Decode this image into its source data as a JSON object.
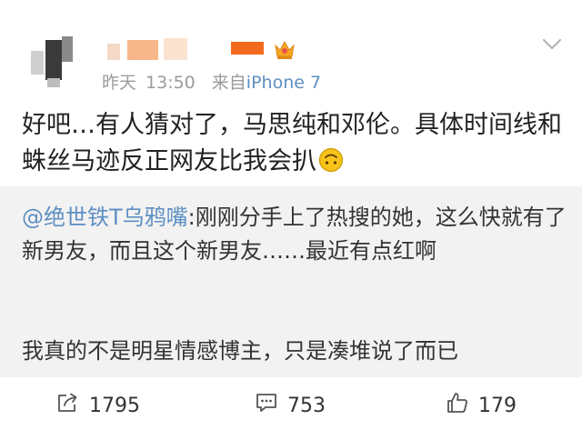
{
  "post": {
    "time_prefix": "昨天",
    "time": "13:50",
    "source_prefix": "来自",
    "source_device": "iPhone 7",
    "text": "好吧…有人猜对了，马思纯和邓伦。具体时间线和蛛丝马迹反正网友比我会扒",
    "emoji_icon": "upside-down-face-icon"
  },
  "repost": {
    "author": "@绝世铁T乌鸦嘴",
    "separator": ":",
    "text": "刚刚分手上了热搜的她，这么快就有了新男友，而且这个新男友……最近有点红啊",
    "extra": "我真的不是明星情感博主，只是凑堆说了而已"
  },
  "actions": {
    "repost_count": "1795",
    "comment_count": "753",
    "like_count": "179"
  },
  "colors": {
    "link": "#5d8fc2",
    "meta": "#9b9b9b",
    "repost_bg": "#f2f2f2",
    "crown": "#f5a623",
    "emoji": "#f7c31a"
  }
}
